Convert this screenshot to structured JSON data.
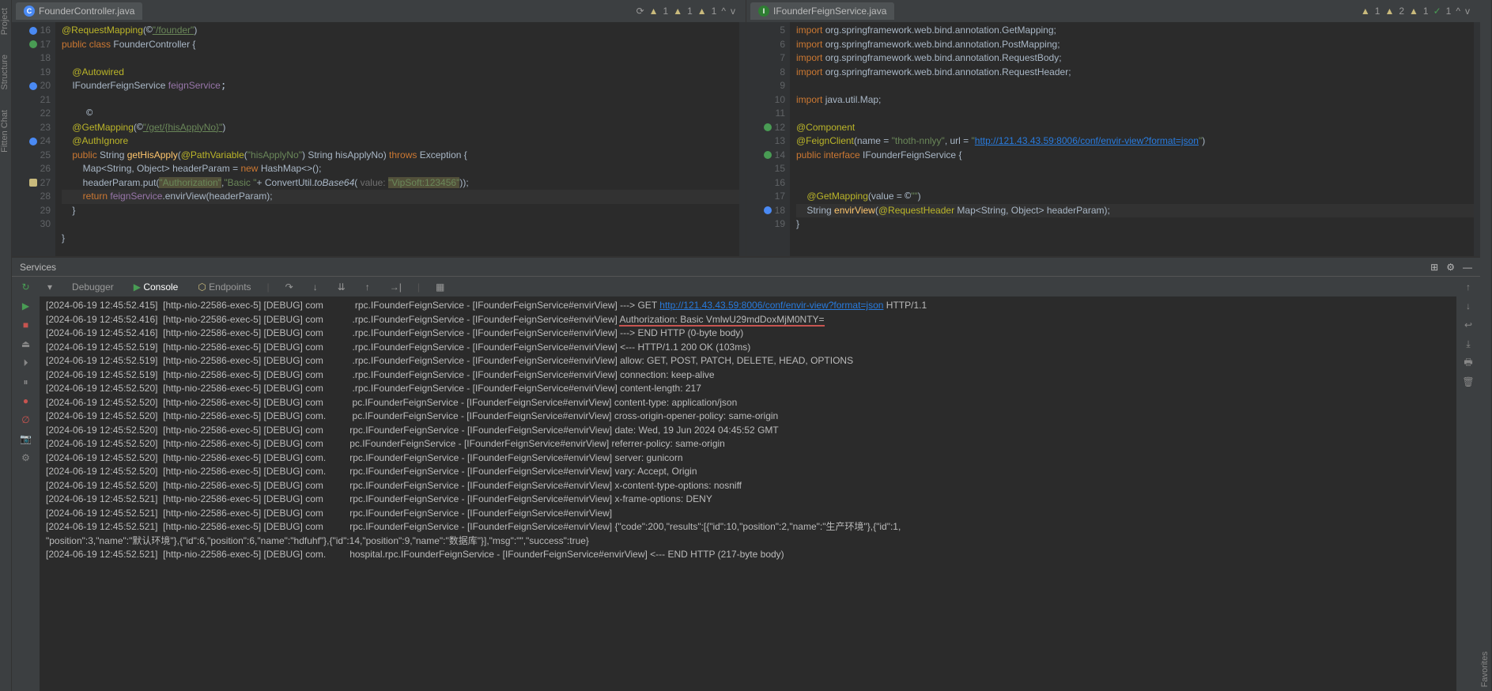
{
  "leftTools": [
    "Project",
    "Structure",
    "Fitten Chat"
  ],
  "tabs": {
    "left": "FounderController.java",
    "right": "IFounderFeignService.java"
  },
  "warnL": {
    "e": "1",
    "w1": "1",
    "w2": "1"
  },
  "warnR": {
    "e": "1",
    "w1": "2",
    "w2": "1",
    "c": "1"
  },
  "gutterL": [
    "16",
    "17",
    "18",
    "19",
    "20",
    "21",
    "22",
    "23",
    "24",
    "25",
    "26",
    "27",
    "28",
    "29",
    "30"
  ],
  "gutterR": [
    "5",
    "6",
    "7",
    "8",
    "9",
    "10",
    "11",
    "12",
    "13",
    "14",
    "15",
    "16",
    "17",
    "18",
    "19"
  ],
  "codeL": {
    "l16a": "@RequestMapping",
    "l16b": "(",
    "l16c": "\"/founder\"",
    "l16d": ")",
    "l17a": "public class ",
    "l17b": "FounderController {",
    "l19a": "    @Autowired",
    "l20a": "    IFounderFeignService ",
    "l20b": "feignService",
    "l23a": "    @GetMapping",
    "l23b": "(",
    "l23c": "\"/get/{hisApplyNo}\"",
    "l23d": ")",
    "l24a": "    @AuthIgnore",
    "l25a": "    public ",
    "l25b": "String ",
    "l25c": "getHisApply",
    "l25d": "(",
    "l25e": "@PathVariable",
    "l25f": "(",
    "l25g": "\"hisApplyNo\"",
    "l25h": ") String hisApplyNo) ",
    "l25i": "throws ",
    "l25j": "Exception {",
    "l26a": "        Map<String, Object> headerParam = ",
    "l26b": "new ",
    "l26c": "HashMap<>();",
    "l27a": "        headerParam.put(",
    "l27b": "\"Authorization\"",
    "l27c": ",",
    "l27d": "\"Basic \"",
    "l27e": "+ ConvertUtil.",
    "l27f": "toBase64",
    "l27g": "(",
    "l27h": " value: ",
    "l27i": "\"VipSoft:123456\"",
    "l27j": "));",
    "l28a": "        return ",
    "l28b": "feignService",
    "l28c": ".envirView(headerParam);",
    "l29a": "    }",
    "l31a": "}"
  },
  "codeR": {
    "l5a": "import ",
    "l5b": "org.springframework.web.bind.annotation.GetMapping;",
    "l6a": "import ",
    "l6b": "org.springframework.web.bind.annotation.PostMapping;",
    "l7a": "import ",
    "l7b": "org.springframework.web.bind.annotation.RequestBody;",
    "l8a": "import ",
    "l8b": "org.springframework.web.bind.annotation.RequestHeader;",
    "l10a": "import ",
    "l10b": "java.util.Map;",
    "l12a": "@Component",
    "l13a": "@FeignClient",
    "l13b": "(name = ",
    "l13c": "\"thoth-nnlyy\"",
    "l13d": ", url = ",
    "l13e": "\"",
    "l13f": "http://121.43.43.59:8006/conf/envir-view?format=json",
    "l13g": "\"",
    "l13h": ")",
    "l14a": "public interface ",
    "l14b": "IFounderFeignService {",
    "l17a": "    @GetMapping",
    "l17b": "(value = ",
    "l17c": "\"\"",
    "l17d": ")",
    "l18a": "    String ",
    "l18b": "envirView",
    "l18c": "(",
    "l18d": "@RequestHeader ",
    "l18e": "Map<String, Object> headerParam);",
    "l19a": "}"
  },
  "services": "Services",
  "panelTabs": {
    "debugger": "Debugger",
    "console": "Console",
    "endpoints": "Endpoints"
  },
  "url": "http://121.43.43.59:8006/conf/envir-view?format=json",
  "log": {
    "p1": "[2024-06-19 12:45:52.415]  [http-nio-22586-exec-5] [DEBUG] com            rpc.IFounderFeignService - [IFounderFeignService#envirView] ---> GET ",
    "p1b": " HTTP/1.1",
    "p2": "[2024-06-19 12:45:52.416]  [http-nio-22586-exec-5] [DEBUG] com           .rpc.IFounderFeignService - [IFounderFeignService#envirView] ",
    "p2b": "Authorization: Basic VmlwU29mdDoxMjM0NTY=",
    "p3": "[2024-06-19 12:45:52.416]  [http-nio-22586-exec-5] [DEBUG] com           .rpc.IFounderFeignService - [IFounderFeignService#envirView] ---> END HTTP (0-byte body)",
    "p4": "[2024-06-19 12:45:52.519]  [http-nio-22586-exec-5] [DEBUG] com           .rpc.IFounderFeignService - [IFounderFeignService#envirView] <--- HTTP/1.1 200 OK (103ms)",
    "p5": "[2024-06-19 12:45:52.519]  [http-nio-22586-exec-5] [DEBUG] com           .rpc.IFounderFeignService - [IFounderFeignService#envirView] allow: GET, POST, PATCH, DELETE, HEAD, OPTIONS",
    "p6": "[2024-06-19 12:45:52.519]  [http-nio-22586-exec-5] [DEBUG] com           .rpc.IFounderFeignService - [IFounderFeignService#envirView] connection: keep-alive",
    "p7": "[2024-06-19 12:45:52.520]  [http-nio-22586-exec-5] [DEBUG] com           .rpc.IFounderFeignService - [IFounderFeignService#envirView] content-length: 217",
    "p8": "[2024-06-19 12:45:52.520]  [http-nio-22586-exec-5] [DEBUG] com           pc.IFounderFeignService - [IFounderFeignService#envirView] content-type: application/json",
    "p9": "[2024-06-19 12:45:52.520]  [http-nio-22586-exec-5] [DEBUG] com.          pc.IFounderFeignService - [IFounderFeignService#envirView] cross-origin-opener-policy: same-origin",
    "p10": "[2024-06-19 12:45:52.520]  [http-nio-22586-exec-5] [DEBUG] com          rpc.IFounderFeignService - [IFounderFeignService#envirView] date: Wed, 19 Jun 2024 04:45:52 GMT",
    "p11": "[2024-06-19 12:45:52.520]  [http-nio-22586-exec-5] [DEBUG] com          pc.IFounderFeignService - [IFounderFeignService#envirView] referrer-policy: same-origin",
    "p12": "[2024-06-19 12:45:52.520]  [http-nio-22586-exec-5] [DEBUG] com.         rpc.IFounderFeignService - [IFounderFeignService#envirView] server: gunicorn",
    "p13": "[2024-06-19 12:45:52.520]  [http-nio-22586-exec-5] [DEBUG] com.         rpc.IFounderFeignService - [IFounderFeignService#envirView] vary: Accept, Origin",
    "p14": "[2024-06-19 12:45:52.520]  [http-nio-22586-exec-5] [DEBUG] com          rpc.IFounderFeignService - [IFounderFeignService#envirView] x-content-type-options: nosniff",
    "p15": "[2024-06-19 12:45:52.521]  [http-nio-22586-exec-5] [DEBUG] com          rpc.IFounderFeignService - [IFounderFeignService#envirView] x-frame-options: DENY",
    "p16": "[2024-06-19 12:45:52.521]  [http-nio-22586-exec-5] [DEBUG] com          rpc.IFounderFeignService - [IFounderFeignService#envirView]",
    "p17": "[2024-06-19 12:45:52.521]  [http-nio-22586-exec-5] [DEBUG] com          rpc.IFounderFeignService - [IFounderFeignService#envirView] {\"code\":200,\"results\":[{\"id\":10,\"position\":2,\"name\":\"生产环境\"},{\"id\":1,",
    "p18": "\"position\":3,\"name\":\"默认环境\"},{\"id\":6,\"position\":6,\"name\":\"hdfuhf\"},{\"id\":14,\"position\":9,\"name\":\"数据库\"}],\"msg\":\"\",\"success\":true}",
    "p19": "[2024-06-19 12:45:52.521]  [http-nio-22586-exec-5] [DEBUG] com.         hospital.rpc.IFounderFeignService - [IFounderFeignService#envirView] <--- END HTTP (217-byte body)"
  },
  "bottomTools": [
    "Favorites"
  ]
}
